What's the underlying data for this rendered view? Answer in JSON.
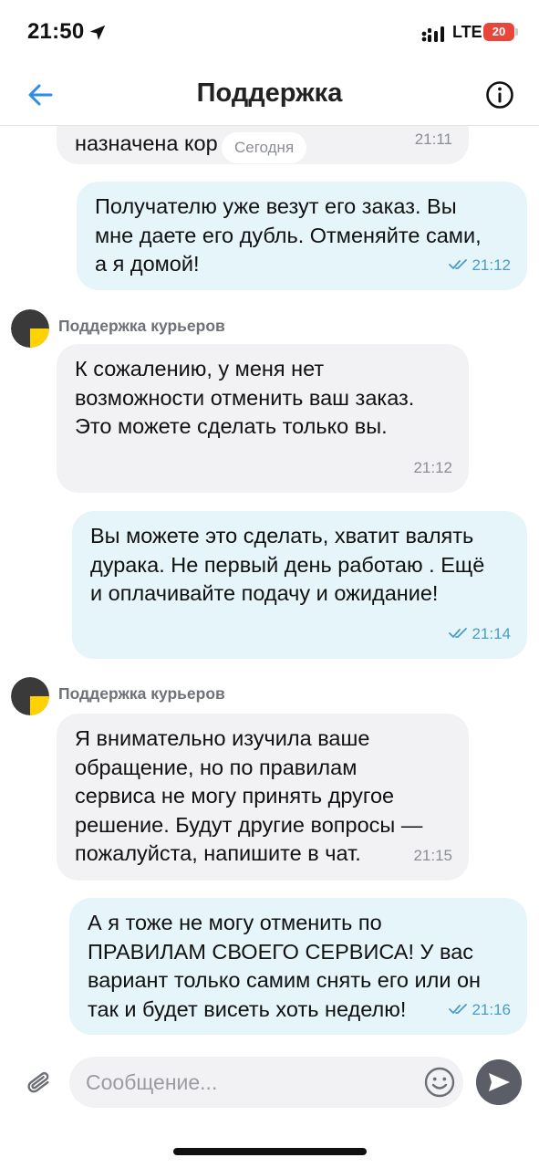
{
  "status": {
    "time": "21:50",
    "network": "LTE",
    "battery": "20"
  },
  "header": {
    "title": "Поддержка",
    "back_icon": "arrow-left-icon",
    "info_icon": "info-circle-icon"
  },
  "chat": {
    "date_chip": "Сегодня",
    "partial_message": {
      "text": "назначена кор        овка.",
      "time": "21:11"
    },
    "messages": [
      {
        "direction": "out",
        "text": "Получателю уже везут его заказ. Вы\nмне даете его дубль. Отменяйте сами,\nа я домой!",
        "time": "21:12",
        "read": true
      },
      {
        "direction": "in",
        "sender": "Поддержка курьеров",
        "text": "К сожалению, у меня нет\nвозможности отменить ваш заказ.\nЭто можете сделать только вы.",
        "time": "21:12"
      },
      {
        "direction": "out",
        "text": "Вы можете это сделать, хватит валять\nдурака. Не первый день работаю . Ещё\nи оплачивайте подачу и ожидание!",
        "time": "21:14",
        "read": true
      },
      {
        "direction": "in",
        "sender": "Поддержка курьеров",
        "text": "Я внимательно изучила ваше\nобращение, но по правилам\nсервиса не могу принять другое\nрешение. Будут другие вопросы —\nпожалуйста, напишите в чат.",
        "time": "21:15"
      },
      {
        "direction": "out",
        "text": "А я тоже не могу отменить по\nПРАВИЛАМ СВОЕГО СЕРВИСА! У вас\nвариант только самим снять его или он\nтак и будет висеть хоть неделю!",
        "time": "21:16",
        "read": true
      }
    ]
  },
  "composer": {
    "placeholder": "Сообщение...",
    "value": ""
  },
  "colors": {
    "accent": "#2f8ce6",
    "incoming_bubble": "#f2f2f4",
    "outgoing_bubble": "#e5f5fa",
    "read_check": "#4a9dc4",
    "send_button": "#5b5e66",
    "battery": "#e8463b"
  }
}
